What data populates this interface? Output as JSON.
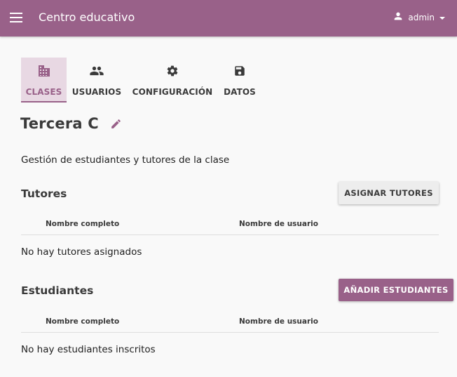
{
  "appbar": {
    "title": "Centro educativo",
    "menu_icon": "hamburger-menu-icon",
    "user": {
      "name": "admin",
      "icon": "person-icon",
      "dropdown_icon": "caret-down-icon"
    },
    "color": "#996189"
  },
  "tabs": [
    {
      "label": "CLASES",
      "icon": "classroom-icon",
      "active": true
    },
    {
      "label": "USUARIOS",
      "icon": "people-icon",
      "active": false
    },
    {
      "label": "CONFIGURACIÓN",
      "icon": "gear-icon",
      "active": false
    },
    {
      "label": "DATOS",
      "icon": "save-icon",
      "active": false
    }
  ],
  "class": {
    "title": "Tercera C",
    "edit_icon": "pencil-icon"
  },
  "description": "Gestión de estudiantes y tutores de la clase",
  "tutors": {
    "title": "Tutores",
    "button_label": "ASIGNAR TUTORES",
    "columns": [
      "Nombre completo",
      "Nombre de usuario"
    ],
    "empty_message": "No hay tutores asignados"
  },
  "students": {
    "title": "Estudiantes",
    "button_label": "AÑADIR ESTUDIANTES",
    "columns": [
      "Nombre completo",
      "Nombre de usuario"
    ],
    "empty_message": "No hay estudiantes inscritos"
  },
  "colors": {
    "primary": "#996189",
    "active_tab_bg": "#e8d8e3",
    "background": "#f9f9f9"
  }
}
